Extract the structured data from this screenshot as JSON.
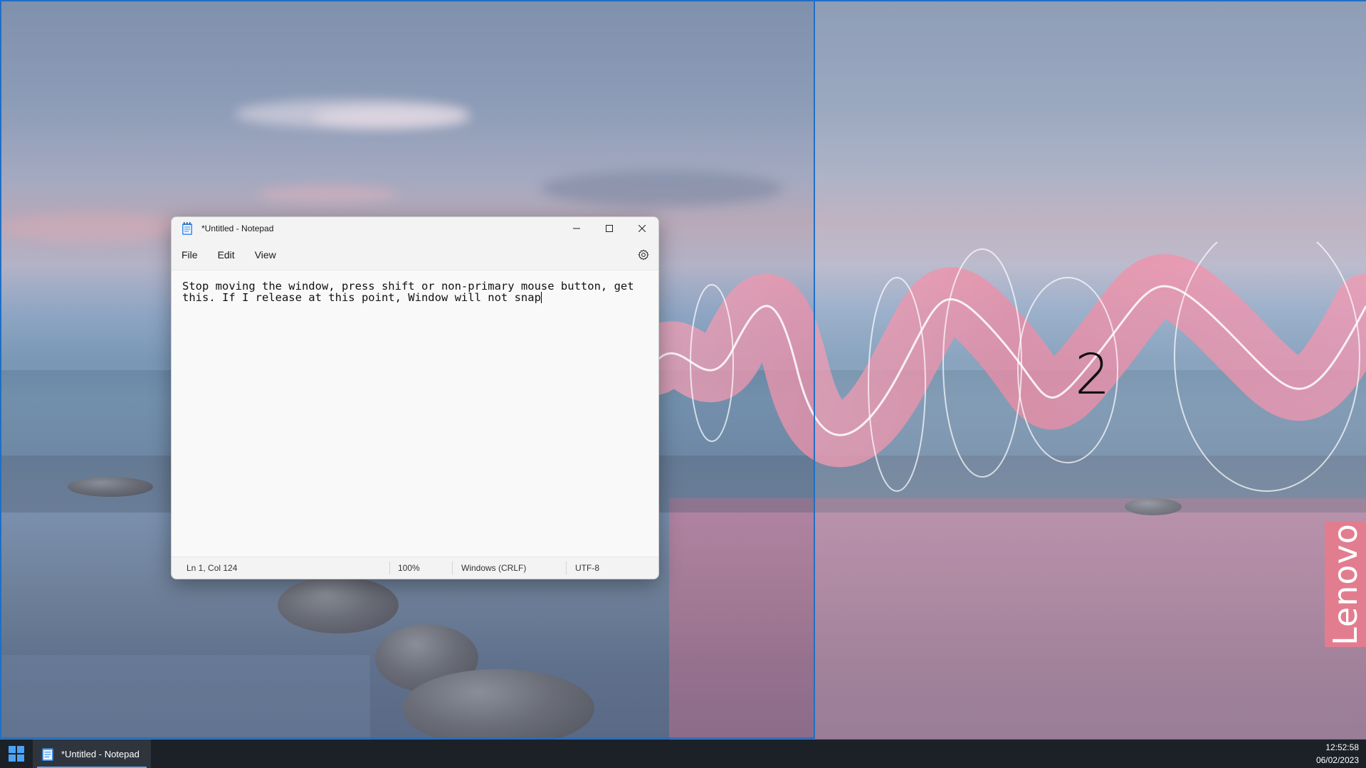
{
  "window": {
    "title": "*Untitled - Notepad",
    "menu": [
      "File",
      "Edit",
      "View"
    ],
    "editor_text": "Stop moving the window, press shift or non-primary mouse button, get this. If I release at this point, Window will not snap",
    "status": {
      "position": "Ln 1, Col 124",
      "zoom": "100%",
      "line_ending": "Windows (CRLF)",
      "encoding": "UTF-8"
    }
  },
  "desktop": {
    "snap_zone_number": "2",
    "brand_text": "Lenovo",
    "snap_zone_color": "#1f6fc5"
  },
  "taskbar": {
    "app_label": "*Untitled - Notepad",
    "time": "12:52:58",
    "date": "06/02/2023"
  }
}
